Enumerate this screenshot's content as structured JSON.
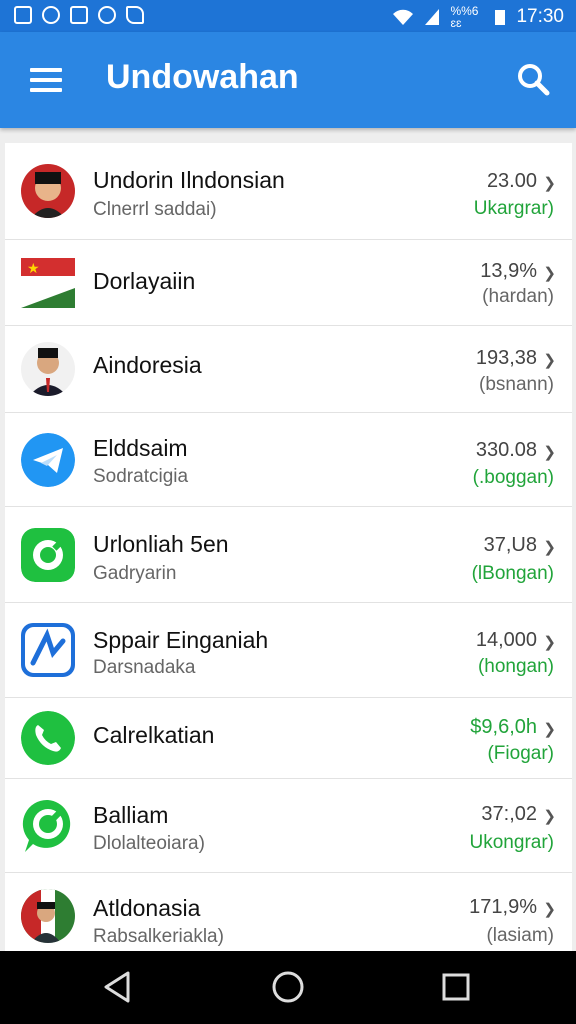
{
  "statusbar": {
    "time": "17:30",
    "small_text": "%%6 ɛɛ"
  },
  "appbar": {
    "title": "Undowahan"
  },
  "items": [
    {
      "name": "Undorin Ilndonsian",
      "sub": "Clnerrl saddai)",
      "value": "23.00",
      "status": "Ukargrar)",
      "status_color": "green",
      "avatar": "person-red"
    },
    {
      "name": "Dorlayaiin",
      "sub": "",
      "value": "13,9%",
      "status": "(hardan)",
      "status_color": "gray",
      "avatar": "flag"
    },
    {
      "name": "Aindoresia",
      "sub": "",
      "value": "193,38",
      "status": "(bsnann)",
      "status_color": "gray",
      "avatar": "person-suit"
    },
    {
      "name": "Elddsaim",
      "sub": "Sodratcigia",
      "value": "330.08",
      "status": "(.boggan)",
      "status_color": "green",
      "avatar": "telegram"
    },
    {
      "name": "Urlonliah 5en",
      "sub": "Gadryarin",
      "value": "37,U8",
      "status": "(lBongan)",
      "status_color": "green",
      "avatar": "green-link"
    },
    {
      "name": "Sppair Einganiah",
      "sub": "Darsnadaka",
      "value": "14,000",
      "status": "(hongan)",
      "status_color": "green",
      "avatar": "blue-app"
    },
    {
      "name": "Calrelkatian",
      "sub": "",
      "value": "$9,6,0h",
      "status": "(Fiogar)",
      "status_color": "green",
      "value_color": "green",
      "avatar": "phone"
    },
    {
      "name": "Balliam",
      "sub": "Dlolalteoiara)",
      "value": "37:,02",
      "status": "Ukongrar)",
      "status_color": "green",
      "avatar": "whatsapp"
    },
    {
      "name": "Atldonasia",
      "sub": "Rabsalkeriakla)",
      "value": "171,9%",
      "status": "(lasiam)",
      "status_color": "gray",
      "avatar": "person-flag"
    }
  ],
  "colors": {
    "primary": "#2b86e3",
    "statusbar": "#1e74d6",
    "accent_green": "#21a43a"
  }
}
